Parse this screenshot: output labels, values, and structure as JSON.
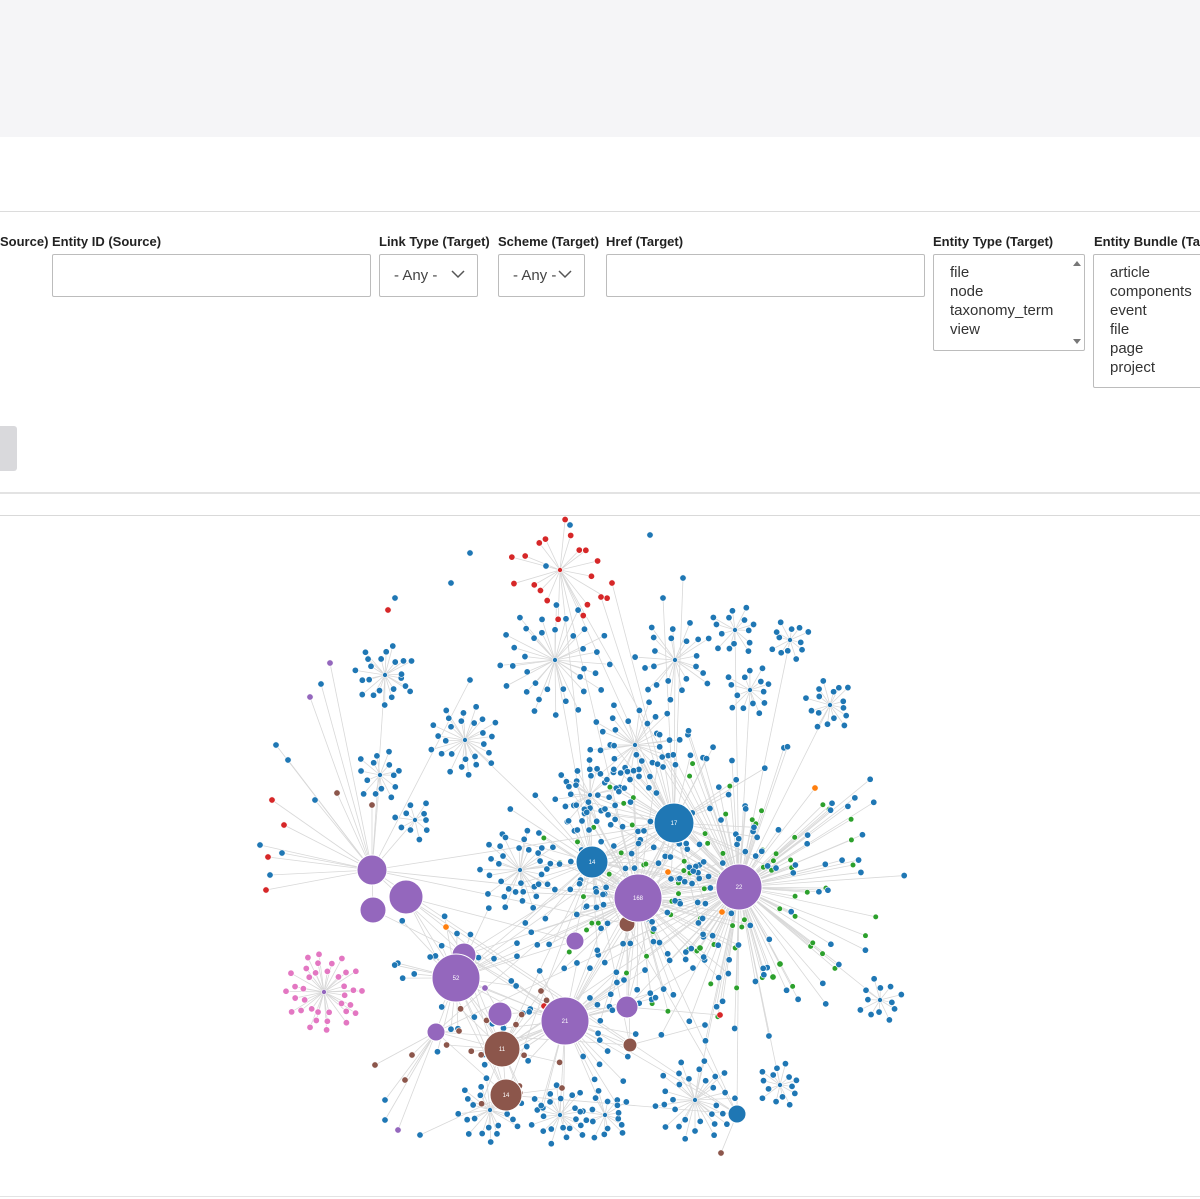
{
  "filters": {
    "entity_type_source_label": "Source)",
    "entity_id_source_label": "Entity ID (Source)",
    "entity_id_source_value": "",
    "link_type_target_label": "Link Type (Target)",
    "link_type_target_value": "- Any -",
    "scheme_target_label": "Scheme (Target)",
    "scheme_target_value": "- Any -",
    "href_target_label": "Href (Target)",
    "href_target_value": "",
    "entity_type_target_label": "Entity Type (Target)",
    "entity_type_target_options": [
      "file",
      "node",
      "taxonomy_term",
      "view"
    ],
    "entity_bundle_target_label": "Entity Bundle (Ta",
    "entity_bundle_target_options": [
      "article",
      "components",
      "event",
      "file",
      "page",
      "project"
    ]
  },
  "graph": {
    "node_colors": {
      "blue": "#1f77b4",
      "purple": "#9467bd",
      "brown": "#8c564b",
      "green": "#2ca02c",
      "red": "#d62728",
      "orange": "#ff7f0e",
      "pink": "#e377c2"
    },
    "edge_color": "#d8d8d8",
    "labeled_nodes": [
      {
        "label": "17",
        "color": "blue"
      },
      {
        "label": "14",
        "color": "blue"
      },
      {
        "label": "168",
        "color": "purple"
      },
      {
        "label": "22",
        "color": "purple"
      },
      {
        "label": "52",
        "color": "purple"
      },
      {
        "label": "21",
        "color": "purple"
      },
      {
        "label": "11",
        "color": "brown"
      },
      {
        "label": "14",
        "color": "brown"
      }
    ]
  }
}
